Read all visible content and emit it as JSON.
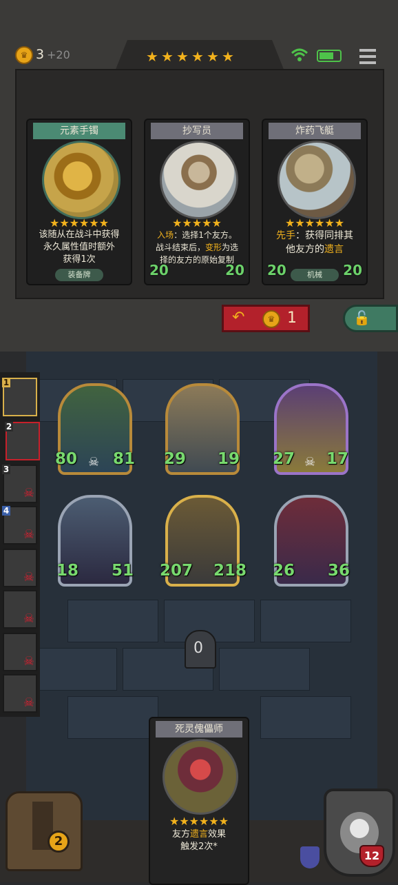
{
  "hud": {
    "gold": "3",
    "gold_income": "+20",
    "tier_stars": 6
  },
  "shop_cards": [
    {
      "title": "元素手镯",
      "desc_lines": [
        "该随从在战斗中获得",
        "永久属性值时额外",
        "获得1次"
      ],
      "tag": "装备牌",
      "attack": "",
      "health": "",
      "frame": "#4b8a73"
    },
    {
      "title": "抄写员",
      "desc_lines": [
        "入场：选择1个友方。",
        "战斗结束后，变形为选",
        "择的友方的原始复制"
      ],
      "tag": "",
      "attack": "20",
      "health": "20",
      "frame": "#7d7d86"
    },
    {
      "title": "炸药飞艇",
      "desc_lines": [
        "先手：获得同排其",
        "他友方的遗言"
      ],
      "tag": "机械",
      "attack": "20",
      "health": "20",
      "frame": "#7d7d86"
    }
  ],
  "refresh": {
    "cost": "1"
  },
  "board": [
    {
      "attack": "80",
      "health": "81"
    },
    {
      "attack": "29",
      "health": "19"
    },
    {
      "attack": "27",
      "health": "17"
    },
    {
      "attack": "18",
      "health": "51"
    },
    {
      "attack": "207",
      "health": "218"
    },
    {
      "attack": "26",
      "health": "36"
    }
  ],
  "sidebar": [
    {
      "rank": "1"
    },
    {
      "rank": "2"
    },
    {
      "rank": "3"
    },
    {
      "rank": "4"
    },
    {
      "rank": ""
    },
    {
      "rank": ""
    },
    {
      "rank": ""
    },
    {
      "rank": ""
    }
  ],
  "center_counter": "0",
  "hand_card": {
    "title": "死灵傀儡师",
    "desc_lines": [
      "友方遗言效果",
      "触发2次*"
    ]
  },
  "chest_level": "2",
  "player_health": "12",
  "colors": {
    "gold": "#f2b21d",
    "health_green": "#6cd16a",
    "dead_red": "#d42030",
    "refresh_red": "#b3212b"
  }
}
